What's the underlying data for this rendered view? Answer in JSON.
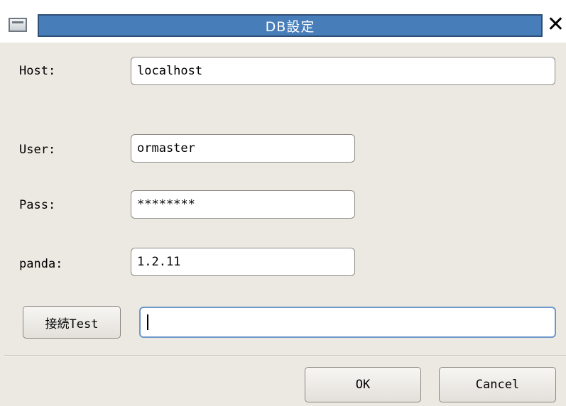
{
  "window": {
    "title": "DB設定"
  },
  "form": {
    "host_label": "Host:",
    "host_value": "localhost",
    "user_label": "User:",
    "user_value": "ormaster",
    "pass_label": "Pass:",
    "pass_value": "********",
    "panda_label": "panda:",
    "panda_value": "1.2.11"
  },
  "connection": {
    "test_button_label": "接続Test",
    "result_value": ""
  },
  "buttons": {
    "ok_label": "OK",
    "cancel_label": "Cancel"
  },
  "icons": {
    "window_menu": "window-menu-icon",
    "close": "close-icon"
  },
  "colors": {
    "titlebar": "#477db8",
    "dialog_background": "#ece9e2",
    "focus_border": "#6d97c9"
  }
}
